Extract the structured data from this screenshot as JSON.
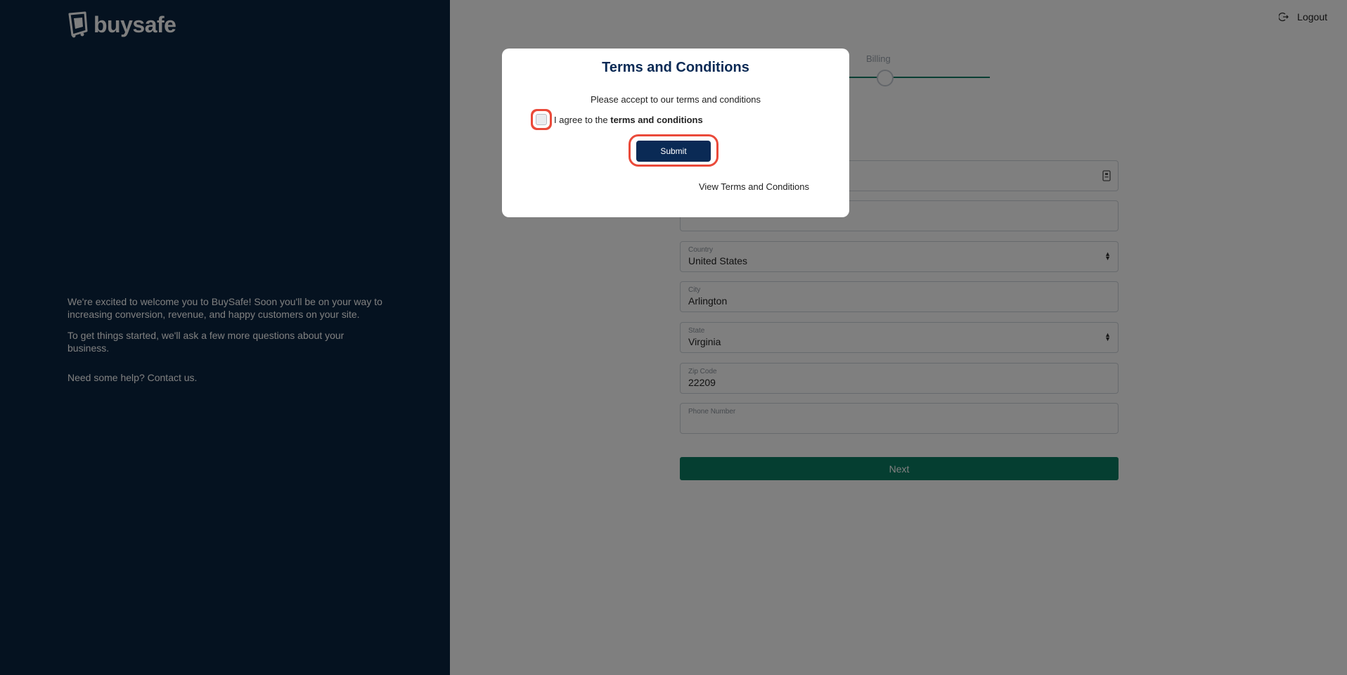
{
  "brand": {
    "name": "buysafe",
    "panel_color": "#0a2540",
    "accent_color": "#0b7d62"
  },
  "welcome": {
    "line1": "We're excited to welcome you to BuySafe! Soon you'll be on your way to increasing conversion, revenue, and happy customers on your site.",
    "line2": "To get things started, we'll ask a few more questions about your business.",
    "help": "Need some help? Contact us."
  },
  "header": {
    "logout_label": "Logout",
    "logout_icon": "logout-icon"
  },
  "stepper": {
    "current_step_label": "Billing"
  },
  "form": {
    "fields": [
      {
        "label": "",
        "value": "",
        "icon": "address-card-icon"
      },
      {
        "label": "",
        "value": ""
      },
      {
        "label": "Country",
        "value": "United States",
        "type": "select"
      },
      {
        "label": "City",
        "value": "Arlington"
      },
      {
        "label": "State",
        "value": "Virginia",
        "type": "select"
      },
      {
        "label": "Zip Code",
        "value": "22209"
      },
      {
        "label": "Phone Number",
        "value": ""
      }
    ],
    "next_label": "Next"
  },
  "modal": {
    "title": "Terms and Conditions",
    "subtitle": "Please accept to our terms and conditions",
    "agree_prefix": "I agree to the ",
    "agree_bold": "terms and conditions",
    "agree_checked": false,
    "submit_label": "Submit",
    "view_terms_label": "View Terms and Conditions",
    "title_color": "#0a2a55",
    "highlight_color": "#ea4a3a"
  }
}
